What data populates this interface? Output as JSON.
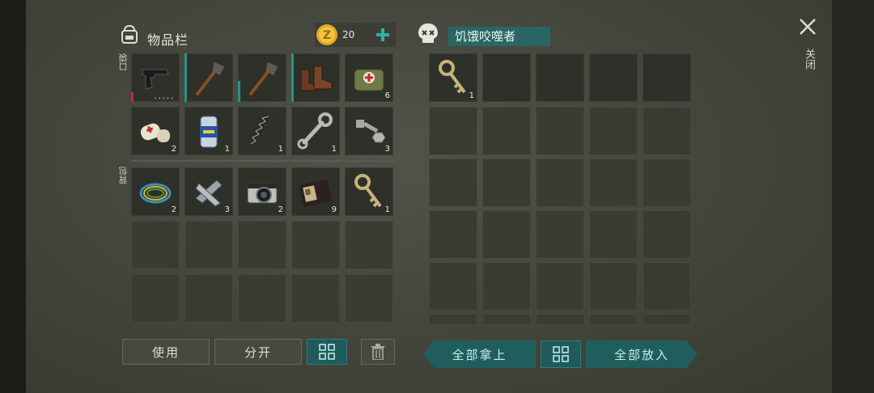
{
  "inventory": {
    "title": "物品栏",
    "coins": "20",
    "pocket_label": "口袋",
    "backpack_label": "背包",
    "pocket_slots": [
      {
        "item": "pistol-icon",
        "count": ""
      },
      {
        "item": "shovel-icon",
        "count": ""
      },
      {
        "item": "shovel-icon",
        "count": ""
      },
      {
        "item": "boots-icon",
        "count": ""
      },
      {
        "item": "medkit-bag-icon",
        "count": "6"
      },
      {
        "item": "bandage-icon",
        "count": "2"
      },
      {
        "item": "beer-can-icon",
        "count": "1"
      },
      {
        "item": "spring-icon",
        "count": "1"
      },
      {
        "item": "wrench-icon",
        "count": "1"
      },
      {
        "item": "bolt-nut-icon",
        "count": "3"
      }
    ],
    "backpack_slots": [
      {
        "item": "wire-coil-icon",
        "count": "2"
      },
      {
        "item": "tape-icon",
        "count": "3"
      },
      {
        "item": "camera-icon",
        "count": "2"
      },
      {
        "item": "wallet-icon",
        "count": "9"
      },
      {
        "item": "key-icon",
        "count": "1"
      }
    ],
    "buttons": {
      "use": "使用",
      "split": "分开"
    }
  },
  "loot": {
    "name": "饥饿咬噬者",
    "slots": [
      {
        "item": "key-icon",
        "count": "1"
      }
    ],
    "buttons": {
      "take_all": "全部拿上",
      "put_all": "全部放入"
    }
  },
  "close": {
    "label": "关闭"
  },
  "colors": {
    "accent": "#2a6663",
    "durability": "#c62a2a",
    "teal_bar": "#2b8f8a"
  }
}
